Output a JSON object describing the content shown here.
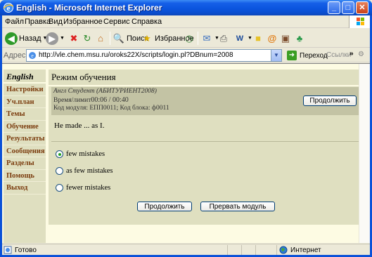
{
  "window": {
    "title": "English - Microsoft Internet Explorer",
    "minimize": "_",
    "maximize": "□",
    "close": "✕"
  },
  "menu": [
    "Файл",
    "Правка",
    "Вид",
    "Избранное",
    "Сервис",
    "Справка"
  ],
  "toolbar": {
    "back_label": "Назад",
    "search_label": "Поиск",
    "favorites_label": "Избранное"
  },
  "address": {
    "label": "Адрес:",
    "url": "http://vle.chem.msu.ru/oroks22X/scripts/login.pl?DBnum=2008",
    "go_label": "Переход",
    "links_label": "Ссылки"
  },
  "sidebar": {
    "heading": "English",
    "items": [
      "Настройки",
      "Уч.план",
      "Темы",
      "Обучение",
      "Результаты",
      "Сообщения",
      "Разделы",
      "Помощь",
      "Выход"
    ]
  },
  "main": {
    "title": "Режим обучения",
    "student_line": "Англ Студент (АБИТУРИЕНТ2008)",
    "time_label": "Время/лимит",
    "time_value": "00:06 / 00:40",
    "codes_line": "Код модуля: ЕПП0011; Код блока: ф0011",
    "continue_top": "Продолжить",
    "question": "He made ... as I.",
    "options": [
      {
        "label": "few mistakes",
        "selected": true
      },
      {
        "label": "as few mistakes",
        "selected": false
      },
      {
        "label": "fewer mistakes",
        "selected": false
      }
    ],
    "continue_bottom": "Продолжить",
    "abort": "Прервать модуль"
  },
  "status": {
    "left": "Готово",
    "zone": "Интернет"
  },
  "colors": {
    "titlebar": "#0a51d8",
    "content_bg": "#fdfbe3",
    "panel_bg": "#dfdfc0",
    "info_bg": "#c3c3a4",
    "sidebar_text": "#7a3b0d"
  }
}
